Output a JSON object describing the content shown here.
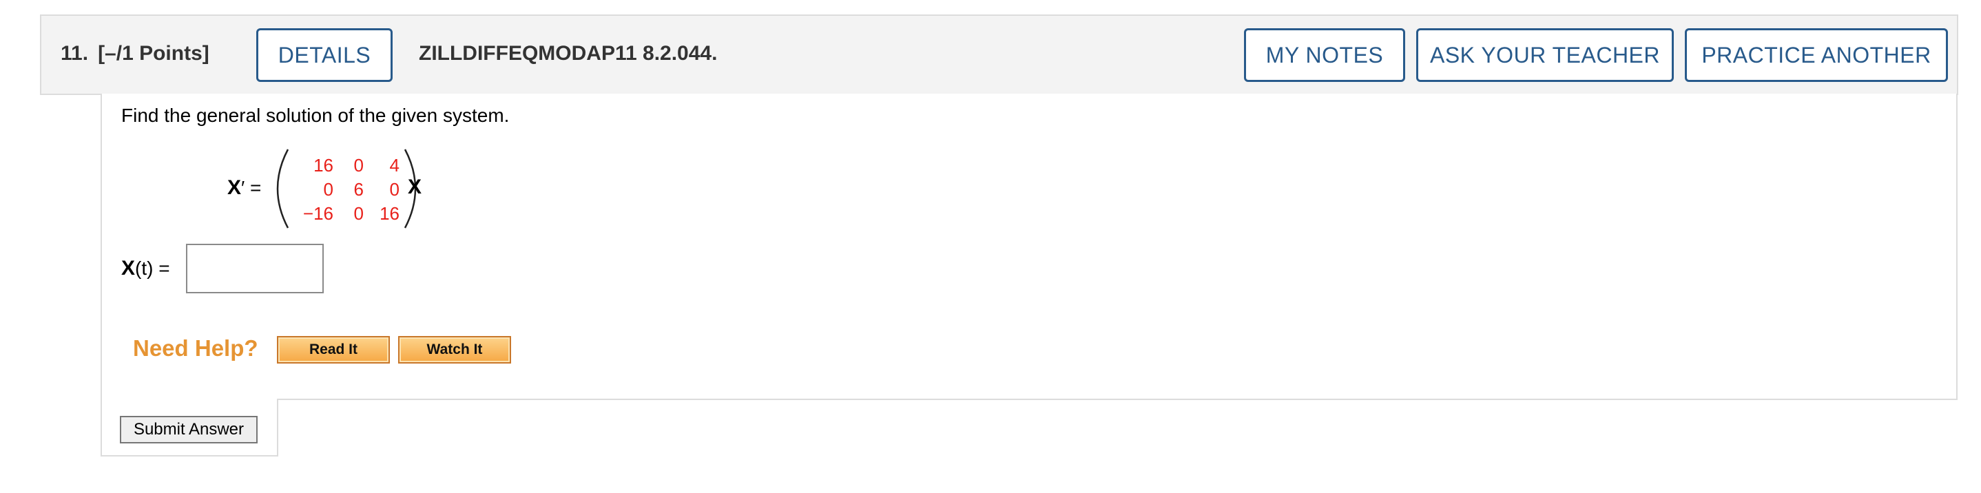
{
  "header": {
    "number": "11.",
    "points": "[–/1 Points]",
    "details_label": "DETAILS",
    "code": "ZILLDIFFEQMODAP11 8.2.044.",
    "my_notes_label": "MY NOTES",
    "ask_teacher_label": "ASK YOUR TEACHER",
    "practice_label": "PRACTICE ANOTHER"
  },
  "question": {
    "prompt": "Find the general solution of the given system.",
    "lhs_symbol": "X",
    "lhs_suffix": "′ =",
    "rhs_symbol": "X",
    "matrix": [
      [
        "16",
        "0",
        "4"
      ],
      [
        "0",
        "6",
        "0"
      ],
      [
        "−16",
        "0",
        "16"
      ]
    ],
    "matrix_color": "#e8201a"
  },
  "answer": {
    "label_symbol": "X",
    "label_var": "(t)",
    "label_suffix": " =",
    "value": "",
    "placeholder": ""
  },
  "help": {
    "label": "Need Help?",
    "read_it": "Read It",
    "watch_it": "Watch It"
  },
  "submit": {
    "label": "Submit Answer"
  },
  "colors": {
    "accent": "#285a8b",
    "help_text": "#e69433",
    "matrix": "#e8201a"
  }
}
